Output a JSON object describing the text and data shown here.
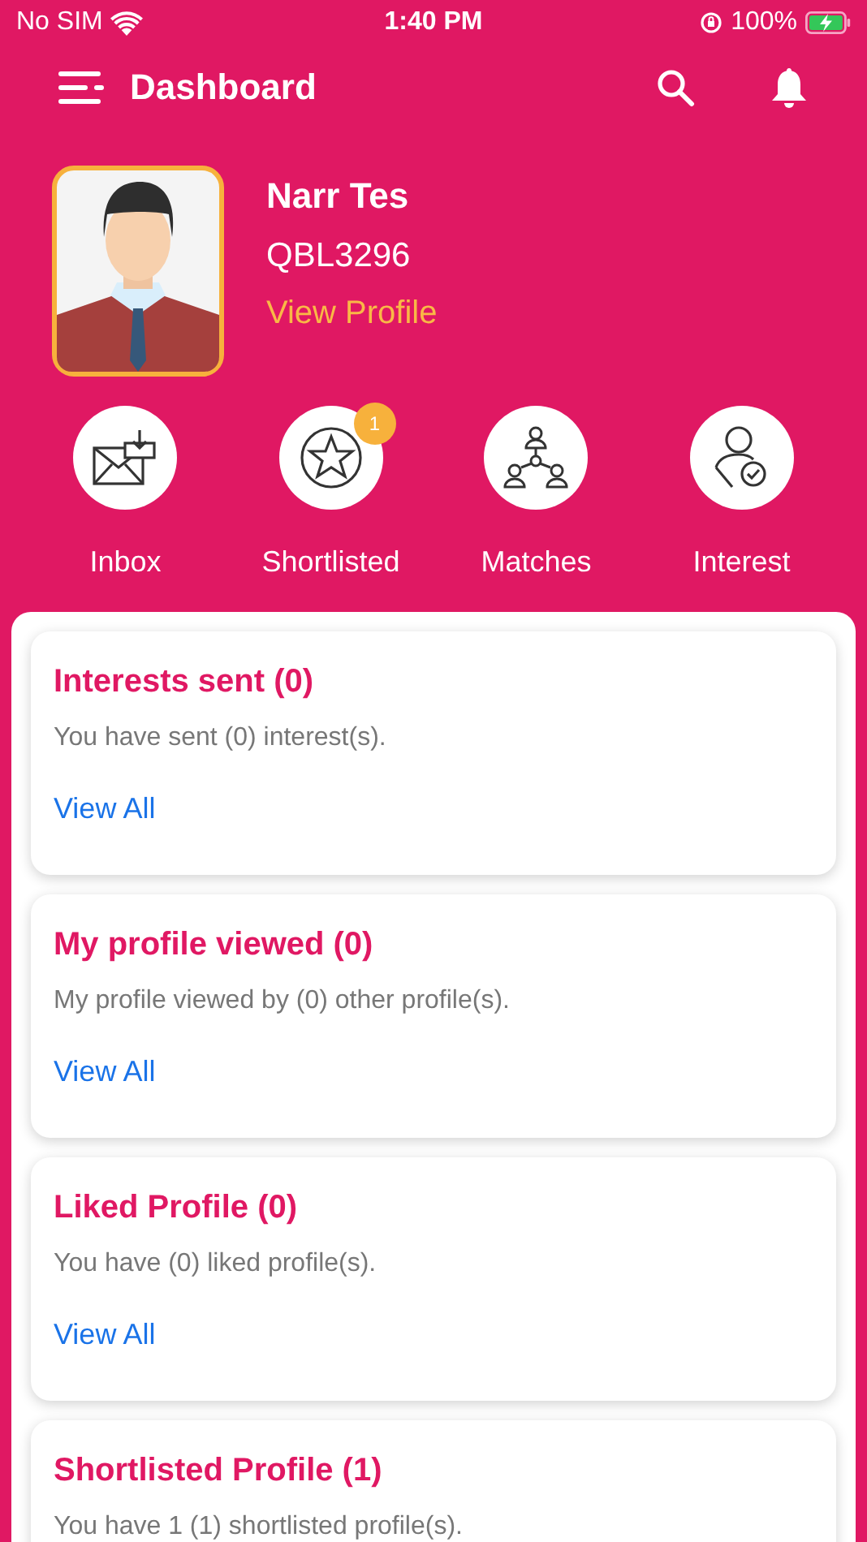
{
  "status_bar": {
    "carrier": "No SIM",
    "time": "1:40 PM",
    "battery": "100%"
  },
  "header": {
    "title": "Dashboard"
  },
  "profile": {
    "name": "Narr Tes",
    "id": "QBL3296",
    "link": "View Profile"
  },
  "quick_links": [
    {
      "kind": "inbox",
      "label": "Inbox"
    },
    {
      "kind": "star",
      "label": "Shortlisted",
      "badge": "1"
    },
    {
      "kind": "matches",
      "label": "Matches"
    },
    {
      "kind": "interest",
      "label": "Interest"
    }
  ],
  "cards": [
    {
      "title": "Interests sent (0)",
      "text": "You have sent (0) interest(s).",
      "link": "View All"
    },
    {
      "title": "My profile viewed (0)",
      "text": "My profile viewed by (0) other profile(s).",
      "link": "View All"
    },
    {
      "title": "Liked Profile (0)",
      "text": "You have (0) liked profile(s).",
      "link": "View All"
    },
    {
      "title": "Shortlisted Profile (1)",
      "text": "You have 1 (1) shortlisted profile(s)."
    }
  ]
}
